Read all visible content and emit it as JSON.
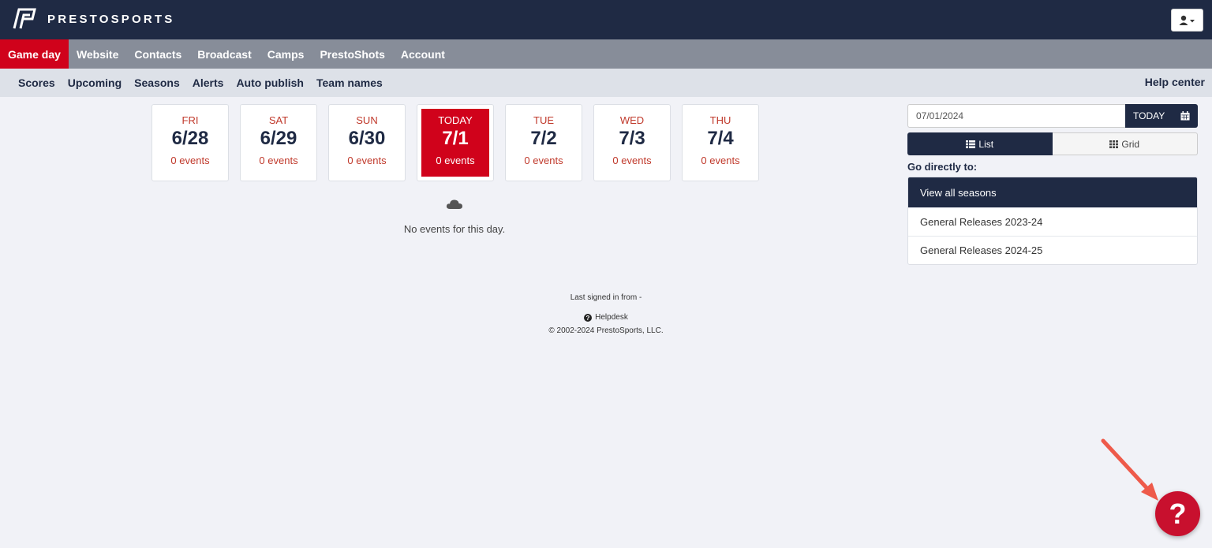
{
  "brand": {
    "name": "PRESTOSPORTS"
  },
  "colors": {
    "navy": "#1f2a44",
    "red": "#d0021b",
    "gray_nav": "#878d99"
  },
  "main_nav": [
    {
      "label": "Game day",
      "active": true
    },
    {
      "label": "Website"
    },
    {
      "label": "Contacts"
    },
    {
      "label": "Broadcast"
    },
    {
      "label": "Camps"
    },
    {
      "label": "PrestoShots"
    },
    {
      "label": "Account"
    }
  ],
  "sub_nav": {
    "items": [
      "Scores",
      "Upcoming",
      "Seasons",
      "Alerts",
      "Auto publish",
      "Team names"
    ],
    "help": "Help center"
  },
  "days": [
    {
      "dow": "FRI",
      "date": "6/28",
      "events": "0 events"
    },
    {
      "dow": "SAT",
      "date": "6/29",
      "events": "0 events"
    },
    {
      "dow": "SUN",
      "date": "6/30",
      "events": "0 events"
    },
    {
      "dow": "TODAY",
      "date": "7/1",
      "events": "0 events",
      "today": true
    },
    {
      "dow": "TUE",
      "date": "7/2",
      "events": "0 events"
    },
    {
      "dow": "WED",
      "date": "7/3",
      "events": "0 events"
    },
    {
      "dow": "THU",
      "date": "7/4",
      "events": "0 events"
    }
  ],
  "empty_message": "No events for this day.",
  "footer": {
    "signed_in": "Last signed in from -",
    "helpdesk": "Helpdesk",
    "copyright": "© 2002-2024 PrestoSports, LLC."
  },
  "right_panel": {
    "date_value": "07/01/2024",
    "today_label": "TODAY",
    "list_label": "List",
    "grid_label": "Grid",
    "goto_label": "Go directly to:",
    "view_all": "View all seasons",
    "seasons": [
      "General Releases 2023-24",
      "General Releases 2024-25"
    ]
  },
  "help_bubble": {
    "label": "?"
  }
}
